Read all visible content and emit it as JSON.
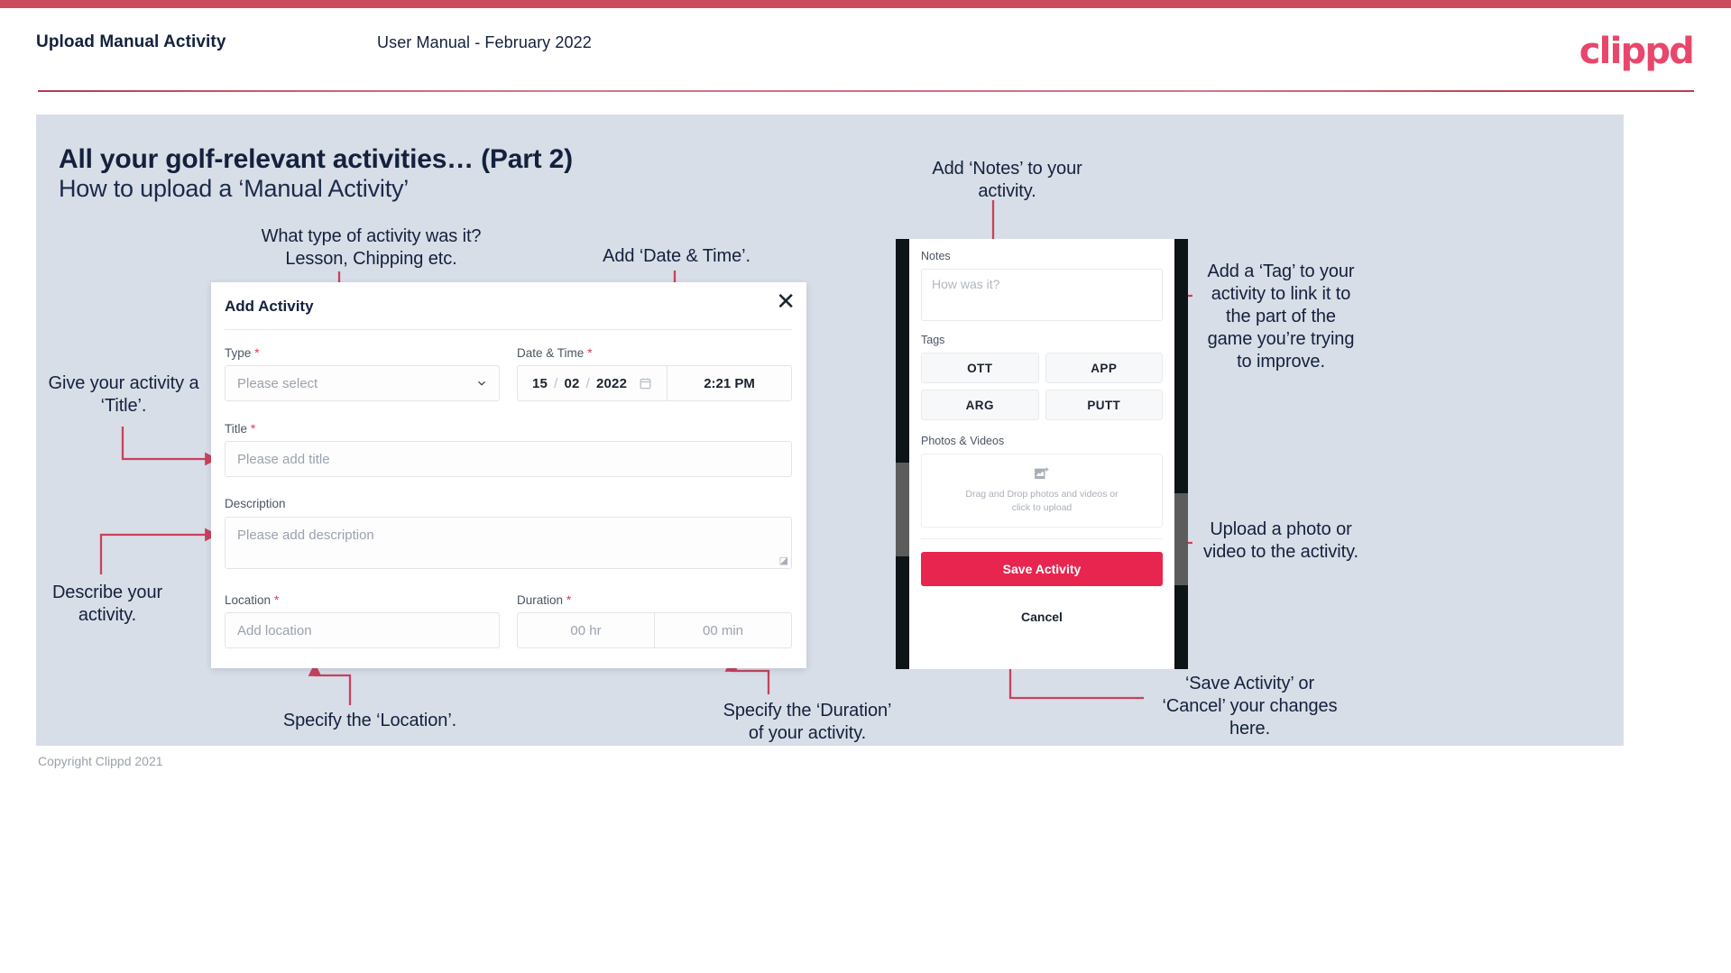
{
  "header": {
    "left_title": "Upload Manual Activity",
    "center_title": "User Manual - February 2022",
    "logo": "clippd"
  },
  "slide": {
    "title": "All your golf-relevant activities… (Part 2)",
    "subtitle": "How to upload a ‘Manual Activity’",
    "footer": "Copyright Clippd 2021"
  },
  "annotations": {
    "type": "What type of activity was it?\nLesson, Chipping etc.",
    "date_time": "Add ‘Date & Time’.",
    "notes": "Add ‘Notes’ to your\nactivity.",
    "tag": "Add a ‘Tag’ to your\nactivity to link it to\nthe part of the\ngame you’re trying\nto improve.",
    "title_field": "Give your activity a\n‘Title’.",
    "description": "Describe your\nactivity.",
    "location": "Specify the ‘Location’.",
    "duration": "Specify the ‘Duration’\nof your activity.",
    "upload": "Upload a photo or\nvideo to the activity.",
    "save_cancel": "‘Save Activity’ or\n‘Cancel’ your changes\nhere."
  },
  "modal": {
    "title": "Add Activity",
    "close_icon": "close-icon",
    "fields": {
      "type": {
        "label": "Type",
        "required": true,
        "placeholder": "Please select"
      },
      "datetime": {
        "label": "Date & Time",
        "required": true,
        "day": "15",
        "month": "02",
        "year": "2022",
        "separator": "/",
        "time": "2:21 PM"
      },
      "title": {
        "label": "Title",
        "required": true,
        "placeholder": "Please add title"
      },
      "description": {
        "label": "Description",
        "required": false,
        "placeholder": "Please add description"
      },
      "location": {
        "label": "Location",
        "required": true,
        "placeholder": "Add location"
      },
      "duration": {
        "label": "Duration",
        "required": true,
        "hours": "00 hr",
        "minutes": "00 min"
      }
    }
  },
  "phone": {
    "notes": {
      "label": "Notes",
      "placeholder": "How was it?"
    },
    "tags": {
      "label": "Tags",
      "items": [
        "OTT",
        "APP",
        "ARG",
        "PUTT"
      ]
    },
    "photos": {
      "label": "Photos & Videos",
      "dropzone_line1": "Drag and Drop photos and videos or",
      "dropzone_line2": "click to upload",
      "icon": "add-image-icon"
    },
    "save_label": "Save Activity",
    "cancel_label": "Cancel"
  },
  "colors": {
    "brand_red": "#e8254f",
    "accent_rule": "#ca4a5e",
    "arrow": "#c8425c",
    "slide_bg": "#d8dee7",
    "navy": "#14213d"
  }
}
